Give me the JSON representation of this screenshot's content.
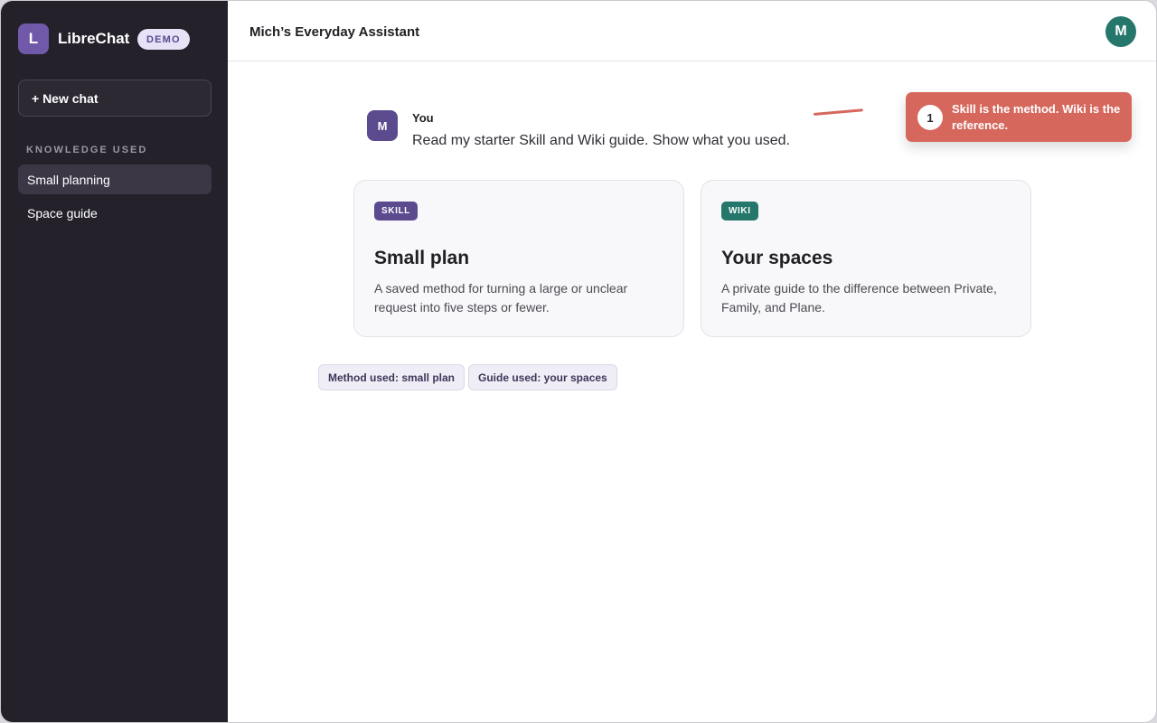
{
  "app": {
    "logo_letter": "L",
    "name": "LibreChat",
    "badge": "DEMO"
  },
  "sidebar": {
    "new_chat_label": "+ New chat",
    "section_label": "KNOWLEDGE USED",
    "items": [
      {
        "label": "Small planning",
        "active": true
      },
      {
        "label": "Space guide",
        "active": false
      }
    ]
  },
  "header": {
    "title": "Mich’s Everyday Assistant",
    "avatar_letter": "M"
  },
  "message": {
    "avatar_letter": "M",
    "author": "You",
    "text": "Read my starter Skill and Wiki guide. Show what you used."
  },
  "callout": {
    "number": "1",
    "text": "Skill is the method. Wiki is the reference."
  },
  "cards": [
    {
      "tag": "SKILL",
      "title": "Small plan",
      "description": "A saved method for turning a large or unclear request into five steps or fewer."
    },
    {
      "tag": "WIKI",
      "title": "Your spaces",
      "description": "A private guide to the difference between Private, Family, and Plane."
    }
  ],
  "pills": [
    {
      "label": "Method used: small plan"
    },
    {
      "label": "Guide used: your spaces"
    }
  ],
  "colors": {
    "sidebar_bg": "#24212b",
    "brand_purple": "#6f59a8",
    "skill_tag": "#5b4a8e",
    "wiki_tag": "#24776a",
    "callout": "#d6675d"
  }
}
